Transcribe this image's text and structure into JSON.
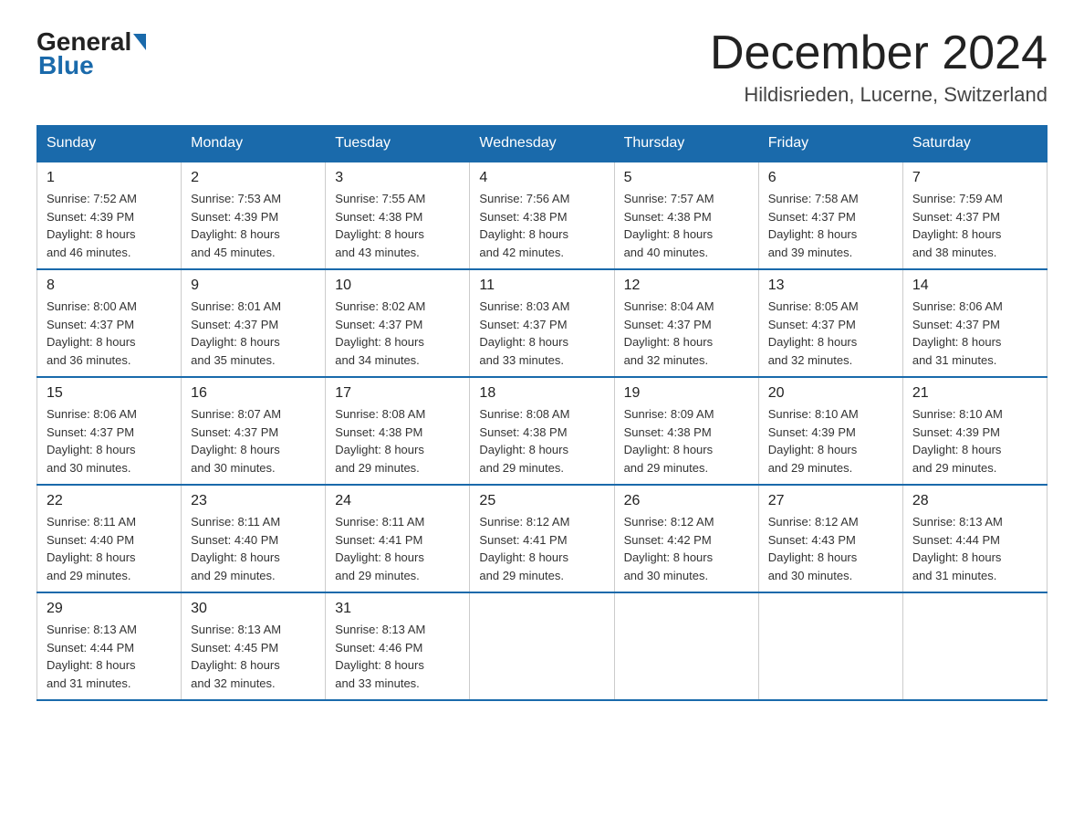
{
  "header": {
    "logo_general": "General",
    "logo_blue": "Blue",
    "month_title": "December 2024",
    "location": "Hildisrieden, Lucerne, Switzerland"
  },
  "days_of_week": [
    "Sunday",
    "Monday",
    "Tuesday",
    "Wednesday",
    "Thursday",
    "Friday",
    "Saturday"
  ],
  "weeks": [
    [
      {
        "day": "1",
        "sunrise": "7:52 AM",
        "sunset": "4:39 PM",
        "daylight": "8 hours and 46 minutes."
      },
      {
        "day": "2",
        "sunrise": "7:53 AM",
        "sunset": "4:39 PM",
        "daylight": "8 hours and 45 minutes."
      },
      {
        "day": "3",
        "sunrise": "7:55 AM",
        "sunset": "4:38 PM",
        "daylight": "8 hours and 43 minutes."
      },
      {
        "day": "4",
        "sunrise": "7:56 AM",
        "sunset": "4:38 PM",
        "daylight": "8 hours and 42 minutes."
      },
      {
        "day": "5",
        "sunrise": "7:57 AM",
        "sunset": "4:38 PM",
        "daylight": "8 hours and 40 minutes."
      },
      {
        "day": "6",
        "sunrise": "7:58 AM",
        "sunset": "4:37 PM",
        "daylight": "8 hours and 39 minutes."
      },
      {
        "day": "7",
        "sunrise": "7:59 AM",
        "sunset": "4:37 PM",
        "daylight": "8 hours and 38 minutes."
      }
    ],
    [
      {
        "day": "8",
        "sunrise": "8:00 AM",
        "sunset": "4:37 PM",
        "daylight": "8 hours and 36 minutes."
      },
      {
        "day": "9",
        "sunrise": "8:01 AM",
        "sunset": "4:37 PM",
        "daylight": "8 hours and 35 minutes."
      },
      {
        "day": "10",
        "sunrise": "8:02 AM",
        "sunset": "4:37 PM",
        "daylight": "8 hours and 34 minutes."
      },
      {
        "day": "11",
        "sunrise": "8:03 AM",
        "sunset": "4:37 PM",
        "daylight": "8 hours and 33 minutes."
      },
      {
        "day": "12",
        "sunrise": "8:04 AM",
        "sunset": "4:37 PM",
        "daylight": "8 hours and 32 minutes."
      },
      {
        "day": "13",
        "sunrise": "8:05 AM",
        "sunset": "4:37 PM",
        "daylight": "8 hours and 32 minutes."
      },
      {
        "day": "14",
        "sunrise": "8:06 AM",
        "sunset": "4:37 PM",
        "daylight": "8 hours and 31 minutes."
      }
    ],
    [
      {
        "day": "15",
        "sunrise": "8:06 AM",
        "sunset": "4:37 PM",
        "daylight": "8 hours and 30 minutes."
      },
      {
        "day": "16",
        "sunrise": "8:07 AM",
        "sunset": "4:37 PM",
        "daylight": "8 hours and 30 minutes."
      },
      {
        "day": "17",
        "sunrise": "8:08 AM",
        "sunset": "4:38 PM",
        "daylight": "8 hours and 29 minutes."
      },
      {
        "day": "18",
        "sunrise": "8:08 AM",
        "sunset": "4:38 PM",
        "daylight": "8 hours and 29 minutes."
      },
      {
        "day": "19",
        "sunrise": "8:09 AM",
        "sunset": "4:38 PM",
        "daylight": "8 hours and 29 minutes."
      },
      {
        "day": "20",
        "sunrise": "8:10 AM",
        "sunset": "4:39 PM",
        "daylight": "8 hours and 29 minutes."
      },
      {
        "day": "21",
        "sunrise": "8:10 AM",
        "sunset": "4:39 PM",
        "daylight": "8 hours and 29 minutes."
      }
    ],
    [
      {
        "day": "22",
        "sunrise": "8:11 AM",
        "sunset": "4:40 PM",
        "daylight": "8 hours and 29 minutes."
      },
      {
        "day": "23",
        "sunrise": "8:11 AM",
        "sunset": "4:40 PM",
        "daylight": "8 hours and 29 minutes."
      },
      {
        "day": "24",
        "sunrise": "8:11 AM",
        "sunset": "4:41 PM",
        "daylight": "8 hours and 29 minutes."
      },
      {
        "day": "25",
        "sunrise": "8:12 AM",
        "sunset": "4:41 PM",
        "daylight": "8 hours and 29 minutes."
      },
      {
        "day": "26",
        "sunrise": "8:12 AM",
        "sunset": "4:42 PM",
        "daylight": "8 hours and 30 minutes."
      },
      {
        "day": "27",
        "sunrise": "8:12 AM",
        "sunset": "4:43 PM",
        "daylight": "8 hours and 30 minutes."
      },
      {
        "day": "28",
        "sunrise": "8:13 AM",
        "sunset": "4:44 PM",
        "daylight": "8 hours and 31 minutes."
      }
    ],
    [
      {
        "day": "29",
        "sunrise": "8:13 AM",
        "sunset": "4:44 PM",
        "daylight": "8 hours and 31 minutes."
      },
      {
        "day": "30",
        "sunrise": "8:13 AM",
        "sunset": "4:45 PM",
        "daylight": "8 hours and 32 minutes."
      },
      {
        "day": "31",
        "sunrise": "8:13 AM",
        "sunset": "4:46 PM",
        "daylight": "8 hours and 33 minutes."
      },
      null,
      null,
      null,
      null
    ]
  ],
  "labels": {
    "sunrise": "Sunrise:",
    "sunset": "Sunset:",
    "daylight": "Daylight:"
  }
}
